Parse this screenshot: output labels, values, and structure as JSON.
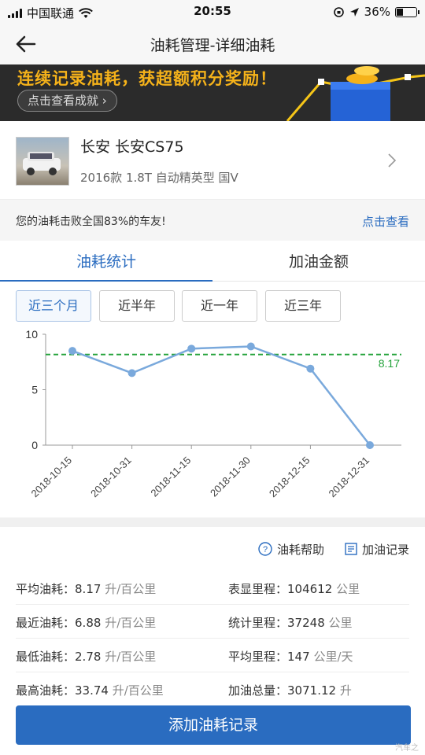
{
  "status_bar": {
    "carrier": "中国联通",
    "time": "20:55",
    "battery": "36%",
    "battery_level": 0.36
  },
  "nav": {
    "title": "油耗管理-详细油耗"
  },
  "banner": {
    "headline": "连续记录油耗，获超额积分奖励！",
    "button": "点击查看成就"
  },
  "car": {
    "name": "长安  长安CS75",
    "spec": "2016款 1.8T 自动精英型 国V"
  },
  "rank": {
    "text": "您的油耗击败全国83%的车友!",
    "link": "点击查看"
  },
  "tabs": [
    {
      "label": "油耗统计",
      "active": true
    },
    {
      "label": "加油金额",
      "active": false
    }
  ],
  "ranges": [
    {
      "label": "近三个月",
      "active": true
    },
    {
      "label": "近半年",
      "active": false
    },
    {
      "label": "近一年",
      "active": false
    },
    {
      "label": "近三年",
      "active": false
    }
  ],
  "chart_data": {
    "type": "line",
    "x": [
      "2018-10-15",
      "2018-10-31",
      "2018-11-15",
      "2018-11-30",
      "2018-12-15",
      "2018-12-31"
    ],
    "values": [
      8.5,
      6.5,
      8.7,
      8.9,
      6.9,
      0
    ],
    "ylim": [
      0,
      10
    ],
    "yticks": [
      "10",
      "5",
      "0"
    ],
    "average": {
      "value": 8.17,
      "label": "8.17"
    },
    "line_color": "#7aa9dc",
    "avg_color": "#23a23a",
    "grid": false
  },
  "links": {
    "help": "油耗帮助",
    "records": "加油记录"
  },
  "stats": [
    {
      "l_label": "平均油耗：",
      "l_val": "8.17",
      "l_unit": "升/百公里",
      "r_label": "表显里程：",
      "r_val": "104612",
      "r_unit": "公里"
    },
    {
      "l_label": "最近油耗：",
      "l_val": "6.88",
      "l_unit": "升/百公里",
      "r_label": "统计里程：",
      "r_val": "37248",
      "r_unit": "公里"
    },
    {
      "l_label": "最低油耗：",
      "l_val": "2.78",
      "l_unit": "升/百公里",
      "r_label": "平均里程：",
      "r_val": "147",
      "r_unit": "公里/天"
    },
    {
      "l_label": "最高油耗：",
      "l_val": "33.74",
      "l_unit": "升/百公里",
      "r_label": "加油总量：",
      "r_val": "3071.12",
      "r_unit": "升"
    }
  ],
  "add_button": "添加油耗记录",
  "watermark": "汽车之"
}
